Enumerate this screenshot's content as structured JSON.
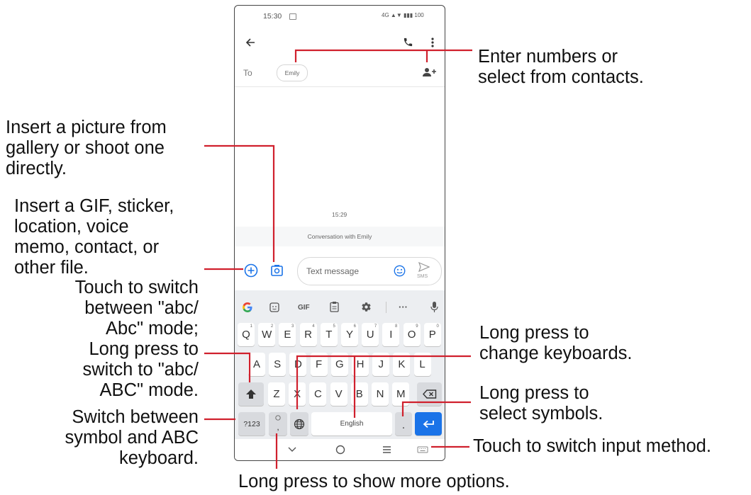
{
  "phone": {
    "status_time": "15:30",
    "status_icons": "4G ▲▼ ▮▮▮ 100",
    "to_label": "To",
    "recipient": "Emily",
    "timestamp": "15:29",
    "conversation_label": "Conversation with Emily",
    "message_placeholder": "Text message",
    "send_label": "SMS",
    "icons": [
      "back-arrow-icon",
      "phone-icon",
      "more-vert-icon",
      "add-contact-icon",
      "add-icon",
      "camera-gallery-icon",
      "emoji-icon",
      "send-icon"
    ]
  },
  "keyboard": {
    "toolbar": {
      "gif_label": "GIF",
      "more_label": "···"
    },
    "row1": [
      {
        "k": "Q",
        "n": "1"
      },
      {
        "k": "W",
        "n": "2"
      },
      {
        "k": "E",
        "n": "3"
      },
      {
        "k": "R",
        "n": "4"
      },
      {
        "k": "T",
        "n": "5"
      },
      {
        "k": "Y",
        "n": "6"
      },
      {
        "k": "U",
        "n": "7"
      },
      {
        "k": "I",
        "n": "8"
      },
      {
        "k": "O",
        "n": "9"
      },
      {
        "k": "P",
        "n": "0"
      }
    ],
    "row2": [
      "A",
      "S",
      "D",
      "F",
      "G",
      "H",
      "J",
      "K",
      "L"
    ],
    "row3": [
      "Z",
      "X",
      "C",
      "V",
      "B",
      "N",
      "M"
    ],
    "symbols_key": "?123",
    "space_label": "English",
    "period_key": ".",
    "comma_key": ","
  },
  "annotations": {
    "contacts": [
      "Enter numbers or",
      "select from contacts."
    ],
    "picture": [
      "Insert a picture from",
      "gallery or shoot one",
      "directly."
    ],
    "attach": [
      "Insert a GIF, sticker,",
      "location, voice",
      "memo, contact, or",
      "other file."
    ],
    "shift": [
      "Touch to switch",
      "between \"abc/",
      "Abc\" mode;",
      "Long press to",
      "switch to \"abc/",
      "ABC\" mode."
    ],
    "symbols": [
      "Switch between",
      "symbol and ABC",
      "keyboard."
    ],
    "keyboards": [
      "Long press to",
      "change keyboards."
    ],
    "period": [
      "Long press to",
      "select symbols."
    ],
    "input_method": [
      "Touch to switch input method."
    ],
    "comma": [
      "Long press to show more options."
    ]
  },
  "colors": {
    "callout_line": "#d0202d",
    "accent": "#1a73e8",
    "keyboard_bg": "#eceef1"
  }
}
